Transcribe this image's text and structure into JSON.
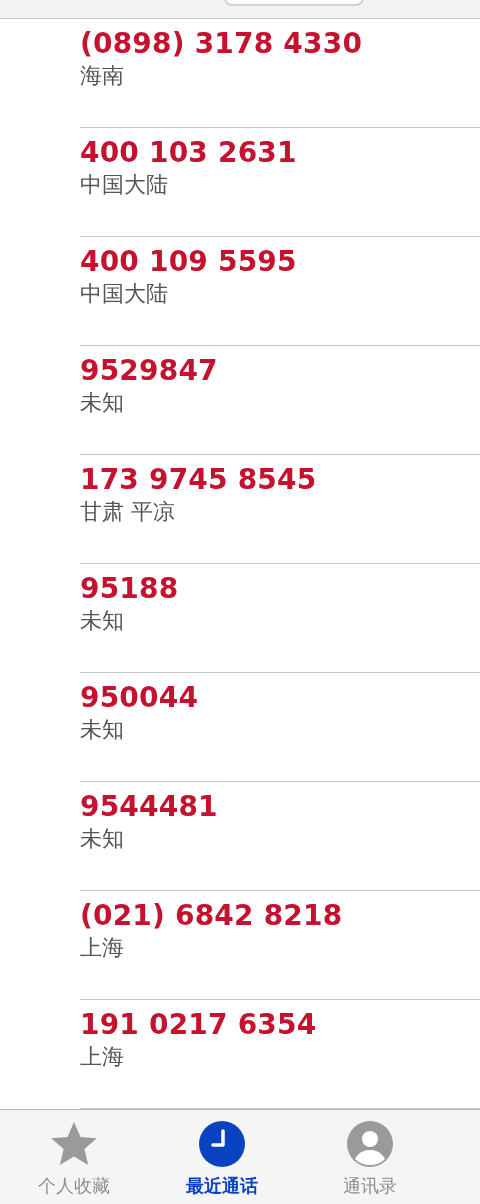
{
  "calls": [
    {
      "number": "(0898) 3178 4330",
      "location": "海南"
    },
    {
      "number": "400 103 2631",
      "location": "中国大陆"
    },
    {
      "number": "400 109 5595",
      "location": "中国大陆"
    },
    {
      "number": "9529847",
      "location": "未知"
    },
    {
      "number": "173 9745 8545",
      "location": "甘肃 平凉"
    },
    {
      "number": "95188",
      "location": "未知"
    },
    {
      "number": "950044",
      "location": "未知"
    },
    {
      "number": "9544481",
      "location": "未知"
    },
    {
      "number": "(021) 6842 8218",
      "location": "上海"
    },
    {
      "number": "191 0217 6354",
      "location": "上海"
    }
  ],
  "tabs": [
    {
      "label": "个人收藏",
      "kind": "star",
      "selected": false
    },
    {
      "label": "最近通话",
      "kind": "clock",
      "selected": true
    },
    {
      "label": "通讯录",
      "kind": "person",
      "selected": false
    }
  ]
}
